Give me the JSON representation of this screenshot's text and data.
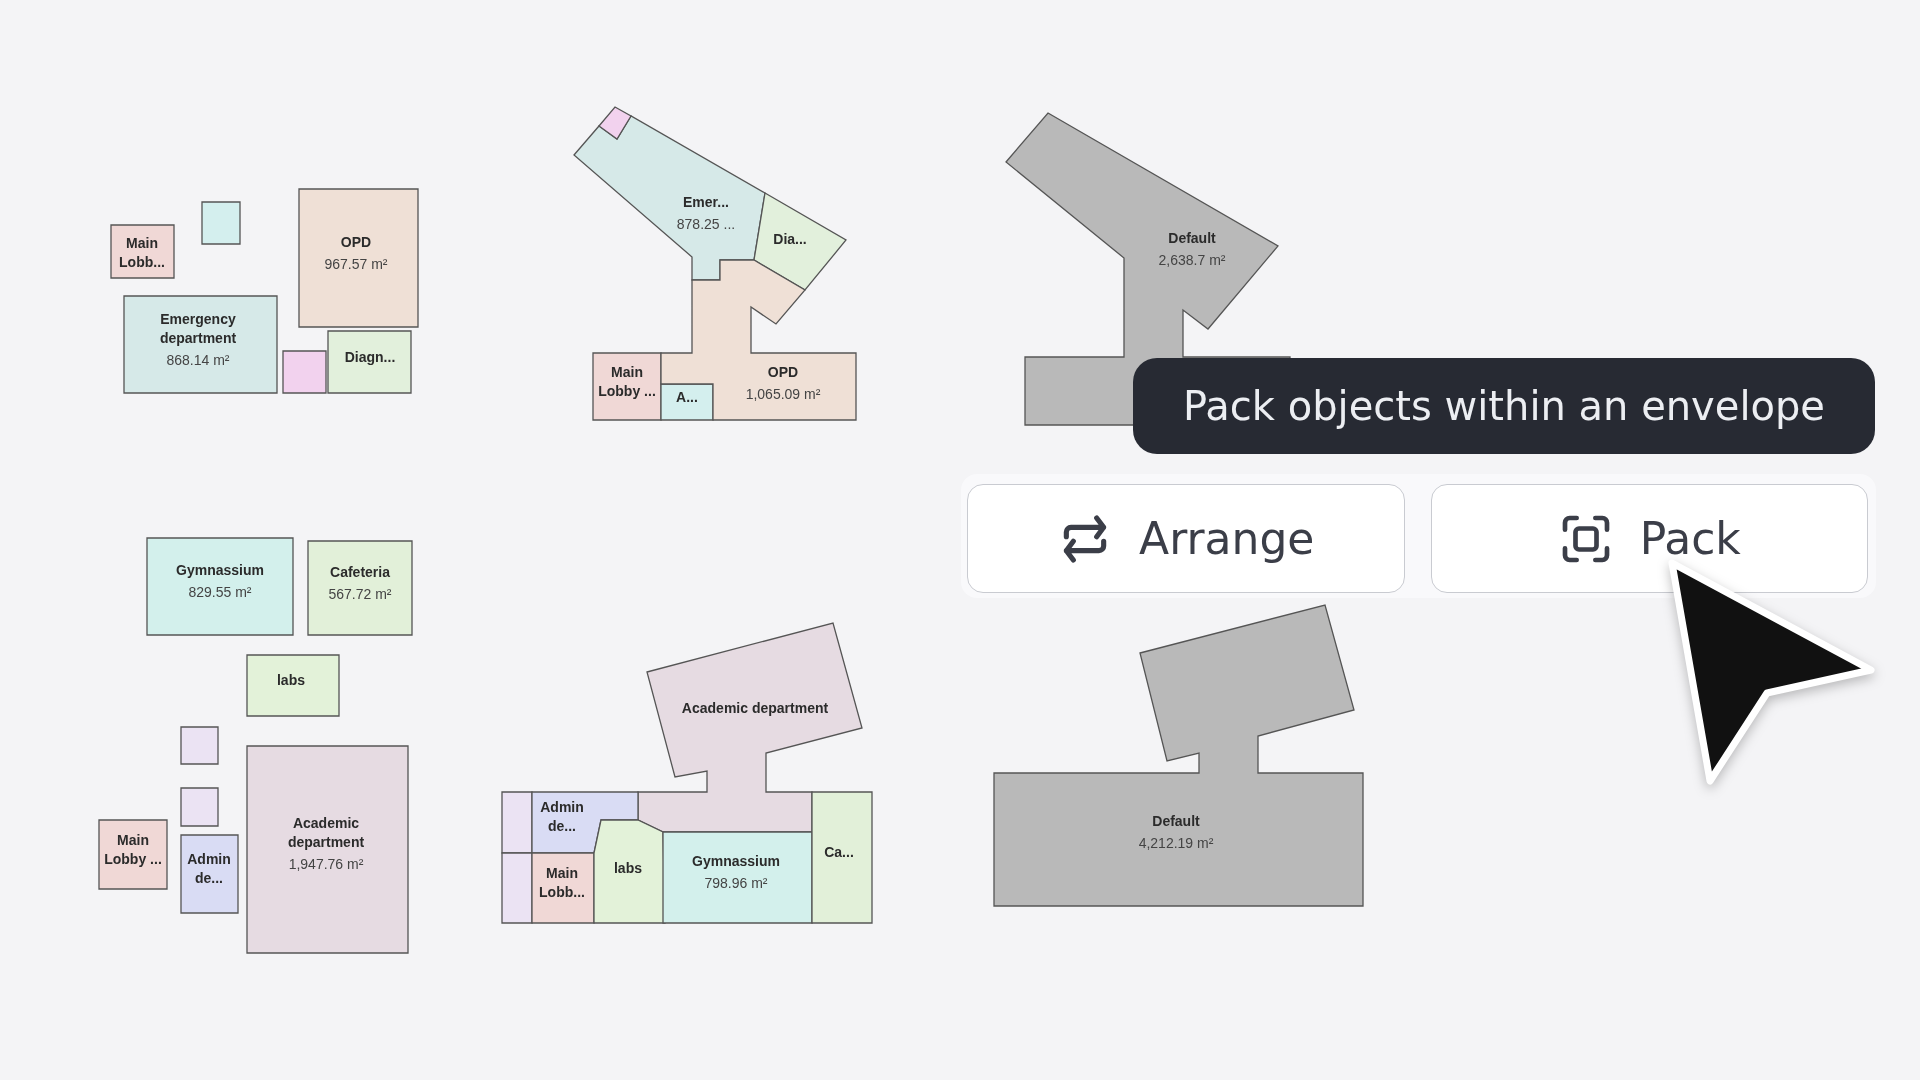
{
  "canvas": {
    "plans": [
      {
        "rooms": [
          {
            "name": "Main Lobb...",
            "color": "#f0d8d6"
          },
          {
            "color": "#d4efee"
          },
          {
            "name": "OPD",
            "area": "967.57 m²",
            "color": "#efe0d6"
          },
          {
            "name": "Emergency department",
            "area": "868.14 m²",
            "color": "#d6e9e8"
          },
          {
            "color": "#f2d2ee"
          },
          {
            "name": "Diagn...",
            "color": "#e2f0dc"
          }
        ]
      },
      {
        "rooms": [
          {
            "name": "Emer...",
            "area": "878.25 ...",
            "color": "#d6e9e8"
          },
          {
            "color": "#f2d2ee"
          },
          {
            "name": "Dia...",
            "color": "#e2f0dc"
          },
          {
            "name": "Main Lobby ...",
            "color": "#f0d8d6"
          },
          {
            "name": "A...",
            "color": "#d4efee"
          },
          {
            "name": "OPD",
            "area": "1,065.09 m²",
            "color": "#efe0d6"
          }
        ]
      },
      {
        "rooms": [
          {
            "name": "Gymnassium",
            "area": "829.55 m²",
            "color": "#d3f0ec"
          },
          {
            "name": "Cafeteria",
            "area": "567.72 m²",
            "color": "#e2f0d9"
          },
          {
            "name": "labs",
            "color": "#e3f2d9"
          },
          {
            "color": "#ebe3f3"
          },
          {
            "color": "#ebe3f3"
          },
          {
            "name": "Main Lobby ...",
            "color": "#f0d8d6"
          },
          {
            "name": "Admin de...",
            "color": "#d9dcf4"
          },
          {
            "name": "Academic department",
            "area": "1,947.76 m²",
            "color": "#e6dbe2"
          }
        ]
      },
      {
        "rooms": [
          {
            "name": "Academic department",
            "color": "#e6dbe2"
          },
          {
            "color": "#ebe3f3"
          },
          {
            "color": "#ebe3f3"
          },
          {
            "name": "Admin de...",
            "color": "#d9dcf4"
          },
          {
            "name": "Main Lobb...",
            "color": "#f0d8d6"
          },
          {
            "name": "labs",
            "color": "#e3f2d9"
          },
          {
            "name": "Gymnassium",
            "area": "798.96 m²",
            "color": "#d3f0ec"
          },
          {
            "name": "Ca...",
            "color": "#e2f0d9"
          }
        ]
      },
      {
        "rooms": [
          {
            "name": "Default",
            "area": "2,638.7 m²",
            "color": "#b9b9b9"
          }
        ]
      },
      {
        "rooms": [
          {
            "name": "Default",
            "area": "4,212.19 m²",
            "color": "#b9b9b9"
          }
        ]
      }
    ]
  },
  "tooltip": {
    "text": "Pack objects within an envelope"
  },
  "buttons": [
    {
      "label": "Arrange",
      "kind": "arrange"
    },
    {
      "label": "Pack",
      "kind": "pack"
    }
  ]
}
